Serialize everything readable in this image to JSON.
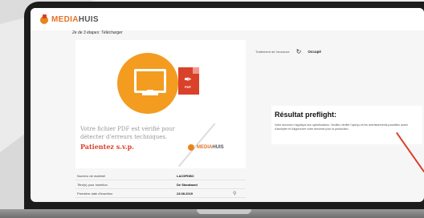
{
  "logo": {
    "brand_prefix": "MEDIA",
    "brand_suffix": "HUIS"
  },
  "step": "2e de 3 étapes: Télécharger",
  "preview": {
    "pdf_label": "PDF",
    "message_line1": "Votre fichier PDF est vérifié pour",
    "message_line2": "détecter d'erreurs techniques.",
    "patience": "Patientez s.v.p."
  },
  "details": [
    {
      "key": "Numéro de matériel",
      "value": "LAC9PDBC"
    },
    {
      "key": "Titre(s) pour insertion",
      "value": "De Standaard"
    },
    {
      "key": "Première date d'insertion",
      "value": "23.08.2019"
    }
  ],
  "processing": {
    "label": "Traitement de l'annonce",
    "status": "Occupé"
  },
  "preflight": {
    "title": "Résultat preflight:",
    "text": "Votre annonce n'applique aux spécifications. Veuillez vérifier l'aperçu et les avertissements possibles avant d'accepter et d'approuver votre annonce pour la production."
  },
  "colors": {
    "accent": "#e2732a",
    "pdf_red": "#d9412a",
    "orange": "#f39c1f"
  }
}
